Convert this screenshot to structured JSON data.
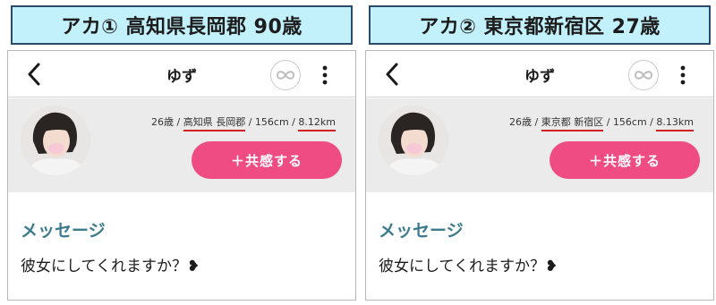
{
  "panels": [
    {
      "account_label": "アカ① 高知県長岡郡 90歳",
      "title": "ゆず",
      "profile": {
        "age": "26歳",
        "sep1": " / ",
        "location": "高知県 長岡郡",
        "sep2": " / ",
        "height": "156cm",
        "sep3": " / ",
        "distance": "8.12km"
      },
      "empathy_button": "＋共感する",
      "section_title": "メッセージ",
      "message": "彼女にしてくれますか？❥"
    },
    {
      "account_label": "アカ② 東京都新宿区 27歳",
      "title": "ゆず",
      "profile": {
        "age": "26歳",
        "sep1": " / ",
        "location": "東京都 新宿区",
        "sep2": " / ",
        "height": "156cm",
        "sep3": " / ",
        "distance": "8.13km"
      },
      "empathy_button": "＋共感する",
      "section_title": "メッセージ",
      "message": "彼女にしてくれますか？❥"
    }
  ],
  "icons": {
    "back": "chevron-left-icon",
    "infinity": "infinity-icon",
    "more": "more-vertical-icon",
    "avatar": "avatar"
  },
  "colors": {
    "label_bg": "#c2f0fb",
    "label_border": "#2a4a6b",
    "accent_pink": "#ee4c82",
    "section_teal": "#3b7b8c",
    "underline_red": "#d42020",
    "band_gray": "#ebebeb"
  }
}
